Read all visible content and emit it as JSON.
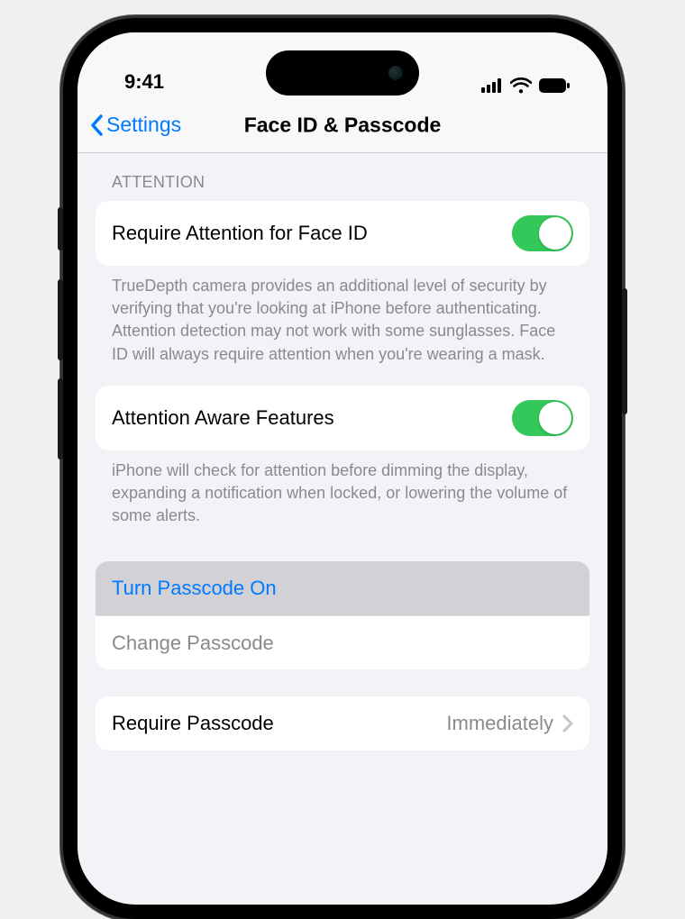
{
  "status": {
    "time": "9:41"
  },
  "nav": {
    "back_label": "Settings",
    "title": "Face ID & Passcode"
  },
  "section_attention": {
    "header": "ATTENTION",
    "require_attention": {
      "label": "Require Attention for Face ID",
      "on": true
    },
    "require_attention_footer": "TrueDepth camera provides an additional level of security by verifying that you're looking at iPhone before authenticating. Attention detection may not work with some sunglasses. Face ID will always require attention when you're wearing a mask.",
    "attention_aware": {
      "label": "Attention Aware Features",
      "on": true
    },
    "attention_aware_footer": "iPhone will check for attention before dimming the display, expanding a notification when locked, or lowering the volume of some alerts."
  },
  "section_passcode": {
    "turn_on_label": "Turn Passcode On",
    "change_label": "Change Passcode"
  },
  "section_require": {
    "label": "Require Passcode",
    "value": "Immediately"
  }
}
